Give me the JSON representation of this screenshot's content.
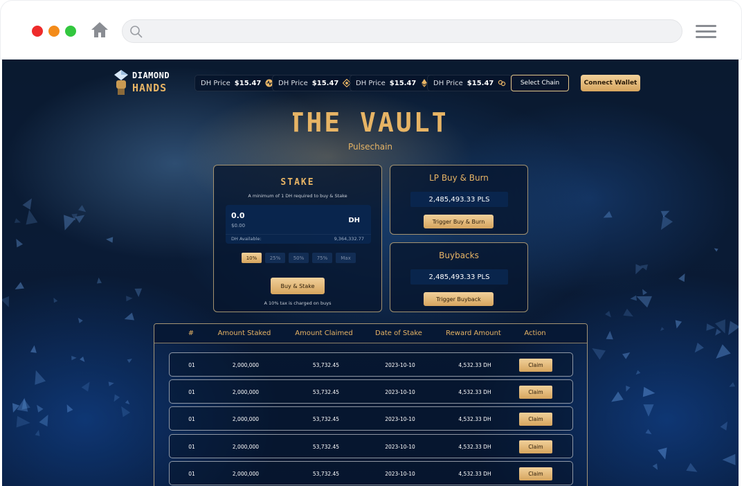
{
  "browser": {
    "url": ""
  },
  "header": {
    "logo": {
      "line1": "DIAMOND",
      "line2": "HANDS"
    },
    "prices": [
      {
        "label": "DH Price",
        "value": "$15.47",
        "icon": "pulsechain-icon"
      },
      {
        "label": "DH Price",
        "value": "$15.47",
        "icon": "bnb-icon"
      },
      {
        "label": "DH Price",
        "value": "$15.47",
        "icon": "ethereum-icon"
      },
      {
        "label": "DH Price",
        "value": "$15.47",
        "icon": "chain-link-icon"
      }
    ],
    "select_chain": "Select Chain",
    "connect_wallet": "Connect Wallet"
  },
  "hero": {
    "title": "THE VAULT",
    "subtitle": "Pulsechain"
  },
  "stake": {
    "title": "STAKE",
    "minimum_note": "A minimum of 1 DH required to buy & Stake",
    "amount": "0.0",
    "amount_usd": "$0.00",
    "token": "DH",
    "available_label": "DH Available:",
    "available_value": "9,364,332.77",
    "percent_options": [
      "10%",
      "25%",
      "50%",
      "75%",
      "Max"
    ],
    "selected_percent": "10%",
    "button": "Buy & Stake",
    "tax_note": "A 10% tax is charged on buys"
  },
  "lp_buy_burn": {
    "title": "LP Buy & Burn",
    "amount": "2,485,493.33 PLS",
    "button": "Trigger Buy & Burn"
  },
  "buybacks": {
    "title": "Buybacks",
    "amount": "2,485,493.33 PLS",
    "button": "Trigger Buyback"
  },
  "table": {
    "columns": [
      "#",
      "Amount  Staked",
      "Amount Claimed",
      "Date of Stake",
      "Reward Amount",
      "Action"
    ],
    "rows": [
      {
        "id": "01",
        "staked": "2,000,000",
        "claimed": "53,732.45",
        "date": "2023-10-10",
        "reward": "4,532.33 DH",
        "action": "Claim"
      },
      {
        "id": "01",
        "staked": "2,000,000",
        "claimed": "53,732.45",
        "date": "2023-10-10",
        "reward": "4,532.33 DH",
        "action": "Claim"
      },
      {
        "id": "01",
        "staked": "2,000,000",
        "claimed": "53,732.45",
        "date": "2023-10-10",
        "reward": "4,532.33 DH",
        "action": "Claim"
      },
      {
        "id": "01",
        "staked": "2,000,000",
        "claimed": "53,732.45",
        "date": "2023-10-10",
        "reward": "4,532.33 DH",
        "action": "Claim"
      },
      {
        "id": "01",
        "staked": "2,000,000",
        "claimed": "53,732.45",
        "date": "2023-10-10",
        "reward": "4,532.33 DH",
        "action": "Claim"
      }
    ]
  },
  "colors": {
    "accent_gold": "#e7b465",
    "background_navy": "#0a1a30",
    "button_gold_light": "#f1d09a",
    "button_gold_dark": "#d6a55e"
  }
}
